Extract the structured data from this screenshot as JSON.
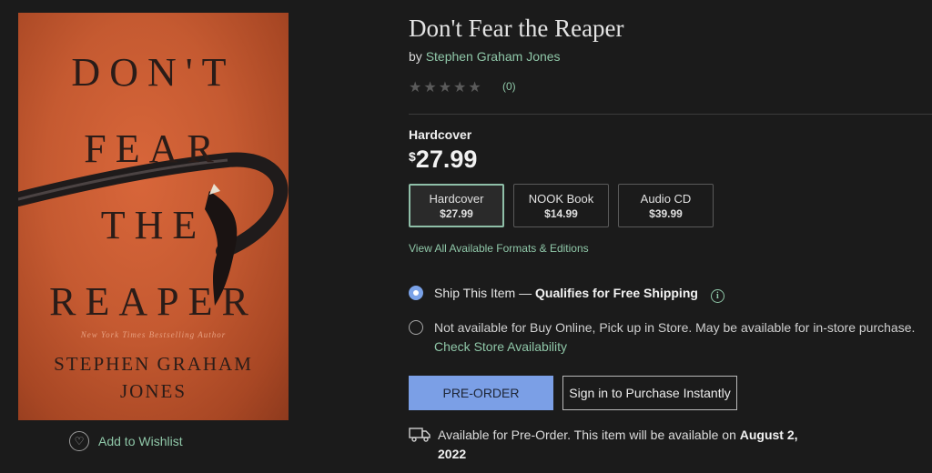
{
  "cover": {
    "title_lines": [
      "DON'T",
      "FEAR",
      "THE",
      "REAPER"
    ],
    "tagline": "New York Times Bestselling Author",
    "author_lines": [
      "STEPHEN GRAHAM",
      "JONES"
    ]
  },
  "wishlist": {
    "label": "Add to Wishlist",
    "icon": "heart-icon"
  },
  "product": {
    "title": "Don't Fear the Reaper",
    "by_prefix": "by",
    "author": "Stephen Graham Jones",
    "rating_count": "(0)",
    "rating_value": 0,
    "format_label": "Hardcover",
    "price_currency": "$",
    "price_amount": "27.99"
  },
  "formats": [
    {
      "name": "Hardcover",
      "price": "$27.99",
      "selected": true
    },
    {
      "name": "NOOK Book",
      "price": "$14.99",
      "selected": false
    },
    {
      "name": "Audio CD",
      "price": "$39.99",
      "selected": false
    }
  ],
  "view_all_link": "View All Available Formats & Editions",
  "shipping": {
    "ship_label": "Ship This Item —",
    "ship_qualifies": "Qualifies for Free Shipping",
    "pickup_text": "Not available for Buy Online, Pick up in Store. May be available for in-store purchase.",
    "store_link": "Check Store Availability"
  },
  "buttons": {
    "preorder": "PRE-ORDER",
    "sign_in": "Sign in to Purchase Instantly"
  },
  "preorder_note": {
    "text": "Available for Pre-Order. This item will be available on",
    "date": "August 2, 2022"
  },
  "colors": {
    "background": "#1b1b1b",
    "link_green": "#8fc7a8",
    "preorder_blue": "#7b9fe6",
    "cover_orange": "#c55a31"
  }
}
